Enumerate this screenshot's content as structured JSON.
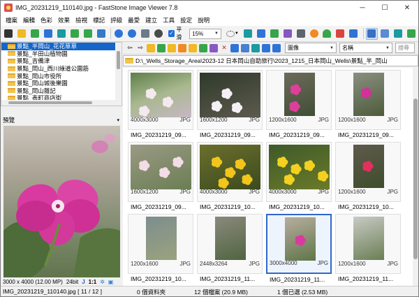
{
  "window": {
    "title": "IMG_20231219_110140.jpg  -  FastStone Image Viewer 7.8",
    "minimize": "─",
    "maximize": "☐",
    "close": "✕"
  },
  "menu": [
    "檔案",
    "編輯",
    "色彩",
    "效果",
    "檢視",
    "標記",
    "評級",
    "最愛",
    "建立",
    "工具",
    "設定",
    "說明"
  ],
  "toolbar": {
    "smooth_label": "平滑",
    "smooth_checked": true,
    "zoom_value": "15%"
  },
  "folders": [
    "景點_半岡山_花花草草",
    "景點_半田山植物園",
    "景點_吉備津",
    "景點_岡山_西川綠道公園筋",
    "景點_岡山市役所",
    "景點_岡山城後樂園",
    "景點_岡山雜記",
    "景點_表町商店街"
  ],
  "preview": {
    "header": "預覽",
    "dimensions": "3000 x 4000 (12.00 MP)",
    "bitdepth": "24bit",
    "jpg_tag": "J",
    "ratio": "1:1"
  },
  "navbar": {
    "filter_value": "圖像",
    "sort_value": "名稱",
    "search_placeholder": "搜尋"
  },
  "path": "D:\\_Wells_Storage_Area\\2023-12 日本岡山自助旅行\\2023_1215_日本岡山_Wells\\景點_半_岡山",
  "thumbnails": [
    {
      "name": "IMG_20231219_09...",
      "dims": "4000x3000",
      "type": "JPG"
    },
    {
      "name": "IMG_20231219_09...",
      "dims": "1600x1200",
      "type": "JPG"
    },
    {
      "name": "IMG_20231219_09...",
      "dims": "1200x1600",
      "type": "JPG"
    },
    {
      "name": "IMG_20231219_09...",
      "dims": "1200x1600",
      "type": "JPG"
    },
    {
      "name": "IMG_20231219_09...",
      "dims": "1600x1200",
      "type": "JPG"
    },
    {
      "name": "IMG_20231219_10...",
      "dims": "4000x3000",
      "type": "JPG"
    },
    {
      "name": "IMG_20231219_10...",
      "dims": "4000x3000",
      "type": "JPG"
    },
    {
      "name": "IMG_20231219_10...",
      "dims": "1200x1600",
      "type": "JPG"
    },
    {
      "name": "IMG_20231219_10...",
      "dims": "1200x1600",
      "type": "JPG"
    },
    {
      "name": "IMG_20231219_11...",
      "dims": "2448x3264",
      "type": "JPG"
    },
    {
      "name": "IMG_20231219_11...",
      "dims": "3000x4000",
      "type": "JPG"
    },
    {
      "name": "IMG_20231219_11...",
      "dims": "1200x1600",
      "type": "JPG"
    }
  ],
  "status": {
    "file": "IMG_20231219_110140.jpg [ 11 / 12 ]",
    "folders": "0 個資料夾",
    "files": "12 個檔案 (20.9 MB)",
    "selected": "1 個已選 (2.53 MB)"
  }
}
